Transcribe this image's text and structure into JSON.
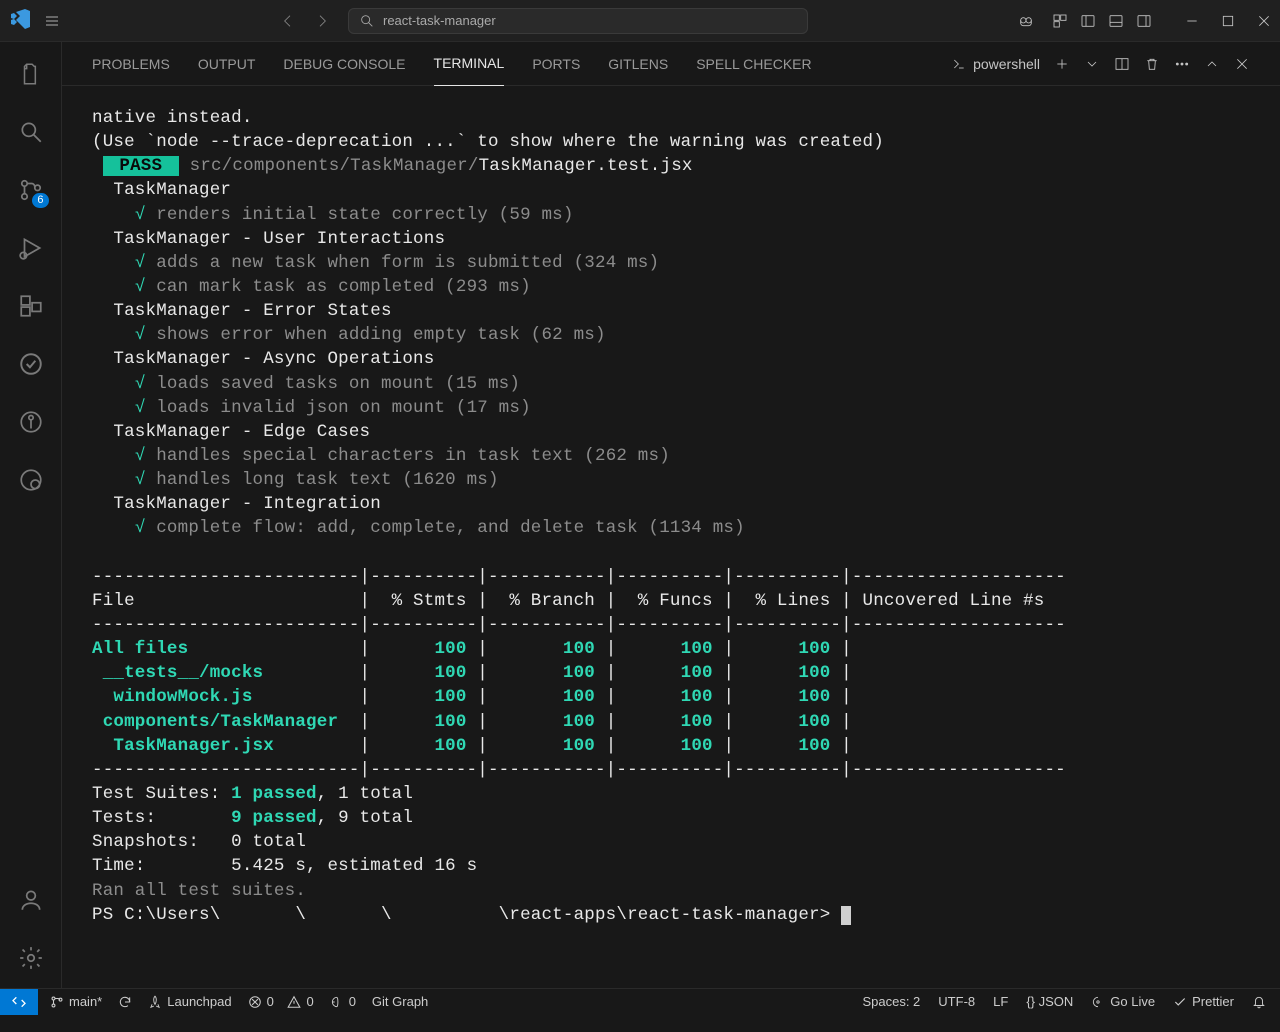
{
  "titlebar": {
    "search_text": "react-task-manager"
  },
  "activitybar": {
    "scm_badge": "6"
  },
  "panel_tabs": {
    "problems": "PROBLEMS",
    "output": "OUTPUT",
    "debug": "DEBUG CONSOLE",
    "terminal": "TERMINAL",
    "ports": "PORTS",
    "gitlens": "GITLENS",
    "spell": "SPELL CHECKER",
    "shell": "powershell"
  },
  "terminal": {
    "pre1": "native instead.",
    "pre2": "(Use `node --trace-deprecation ...` to show where the warning was created)",
    "pass": "PASS",
    "pass_path_gray": "src/components/TaskManager/",
    "pass_file": "TaskManager.test.jsx",
    "suites": [
      {
        "name": "TaskManager",
        "tests": [
          {
            "desc": "renders initial state correctly",
            "time": "59 ms"
          }
        ]
      },
      {
        "name": "TaskManager - User Interactions",
        "tests": [
          {
            "desc": "adds a new task when form is submitted",
            "time": "324 ms"
          },
          {
            "desc": "can mark task as completed",
            "time": "293 ms"
          }
        ]
      },
      {
        "name": "TaskManager - Error States",
        "tests": [
          {
            "desc": "shows error when adding empty task",
            "time": "62 ms"
          }
        ]
      },
      {
        "name": "TaskManager - Async Operations",
        "tests": [
          {
            "desc": "loads saved tasks on mount",
            "time": "15 ms"
          },
          {
            "desc": "loads invalid json on mount",
            "time": "17 ms"
          }
        ]
      },
      {
        "name": "TaskManager - Edge Cases",
        "tests": [
          {
            "desc": "handles special characters in task text",
            "time": "262 ms"
          },
          {
            "desc": "handles long task text",
            "time": "1620 ms"
          }
        ]
      },
      {
        "name": "TaskManager - Integration",
        "tests": [
          {
            "desc": "complete flow: add, complete, and delete task",
            "time": "1134 ms"
          }
        ]
      }
    ],
    "coverage": {
      "headers": [
        "File",
        "% Stmts",
        "% Branch",
        "% Funcs",
        "% Lines",
        "Uncovered Line #s"
      ],
      "rows": [
        {
          "file": "All files",
          "stmts": "100",
          "branch": "100",
          "funcs": "100",
          "lines": "100"
        },
        {
          "file": " __tests__/mocks",
          "stmts": "100",
          "branch": "100",
          "funcs": "100",
          "lines": "100"
        },
        {
          "file": "  windowMock.js",
          "stmts": "100",
          "branch": "100",
          "funcs": "100",
          "lines": "100"
        },
        {
          "file": " components/TaskManager",
          "stmts": "100",
          "branch": "100",
          "funcs": "100",
          "lines": "100"
        },
        {
          "file": "  TaskManager.jsx",
          "stmts": "100",
          "branch": "100",
          "funcs": "100",
          "lines": "100"
        }
      ]
    },
    "summary": {
      "suites_label": "Test Suites:",
      "suites_pass": "1 passed",
      "suites_rest": ", 1 total",
      "tests_label": "Tests:      ",
      "tests_pass": "9 passed",
      "tests_rest": ", 9 total",
      "snap_label": "Snapshots:  ",
      "snap_rest": "0 total",
      "time_label": "Time:       ",
      "time_rest": "5.425 s, estimated 16 s",
      "ran": "Ran all test suites."
    },
    "prompt": "PS C:\\Users\\       \\       \\          \\react-apps\\react-task-manager> "
  },
  "status": {
    "branch": "main*",
    "sync": "",
    "launchpad": "Launchpad",
    "errors": "0",
    "warnings": "0",
    "ports": "0",
    "gitgraph": "Git Graph",
    "spaces": "Spaces: 2",
    "encoding": "UTF-8",
    "eol": "LF",
    "lang": "{} JSON",
    "golive": "Go Live",
    "prettier": "Prettier"
  }
}
